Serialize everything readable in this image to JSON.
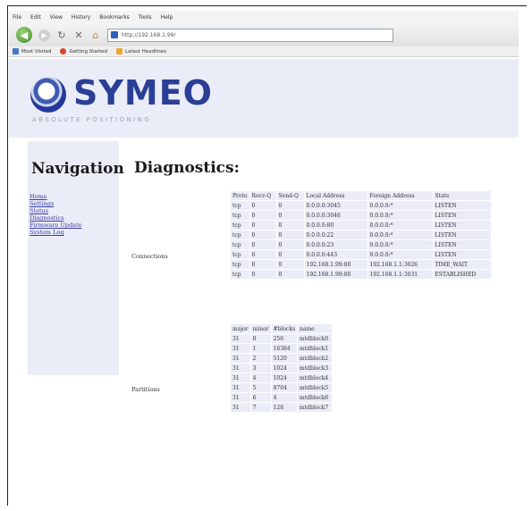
{
  "browser": {
    "menu": [
      "File",
      "Edit",
      "View",
      "History",
      "Bookmarks",
      "Tools",
      "Help"
    ],
    "url": "http://192.168.1.99/",
    "bookmarks": [
      "Most Visited",
      "Getting Started",
      "Latest Headlines"
    ]
  },
  "header": {
    "logo_text": "SYMEO",
    "tagline": "ABSOLUTE POSITIONING"
  },
  "sidebar": {
    "title": "Navigation",
    "items": [
      "Home",
      "Settings",
      "Status",
      "Diagnostics",
      "Firmware Update",
      "System Log"
    ]
  },
  "main": {
    "title": "Diagnostics:",
    "connections": {
      "label": "Connections",
      "headers": [
        "Proto",
        "Recv-Q",
        "Send-Q",
        "Local Address",
        "Foreign Address",
        "State"
      ],
      "rows": [
        [
          "tcp",
          "0",
          "0",
          "0.0.0.0:3045",
          "0.0.0.0:*",
          "LISTEN"
        ],
        [
          "tcp",
          "0",
          "0",
          "0.0.0.0:3046",
          "0.0.0.0:*",
          "LISTEN"
        ],
        [
          "tcp",
          "0",
          "0",
          "0.0.0.0:80",
          "0.0.0.0:*",
          "LISTEN"
        ],
        [
          "tcp",
          "0",
          "0",
          "0.0.0.0:22",
          "0.0.0.0:*",
          "LISTEN"
        ],
        [
          "tcp",
          "0",
          "0",
          "0.0.0.0:23",
          "0.0.0.0:*",
          "LISTEN"
        ],
        [
          "tcp",
          "0",
          "0",
          "0.0.0.0:443",
          "0.0.0.0:*",
          "LISTEN"
        ],
        [
          "tcp",
          "0",
          "0",
          "192.168.1.99:80",
          "192.168.1.1:3026",
          "TIME_WAIT"
        ],
        [
          "tcp",
          "0",
          "0",
          "192.168.1.99:80",
          "192.168.1.1:3031",
          "ESTABLISHED"
        ]
      ]
    },
    "partitions": {
      "label": "Partitions",
      "headers": [
        "major",
        "minor",
        "#blocks",
        "name"
      ],
      "rows": [
        [
          "31",
          "0",
          "256",
          "mtdblock0"
        ],
        [
          "31",
          "1",
          "16384",
          "mtdblock1"
        ],
        [
          "31",
          "2",
          "5120",
          "mtdblock2"
        ],
        [
          "31",
          "3",
          "1024",
          "mtdblock3"
        ],
        [
          "31",
          "4",
          "1024",
          "mtdblock4"
        ],
        [
          "31",
          "5",
          "8704",
          "mtdblock5"
        ],
        [
          "31",
          "6",
          "4",
          "mtdblock6"
        ],
        [
          "31",
          "7",
          "128",
          "mtdblock7"
        ]
      ]
    }
  },
  "colors": {
    "panel": "#eaecf7",
    "brand": "#2a3f95",
    "link": "#3a3fa0"
  }
}
